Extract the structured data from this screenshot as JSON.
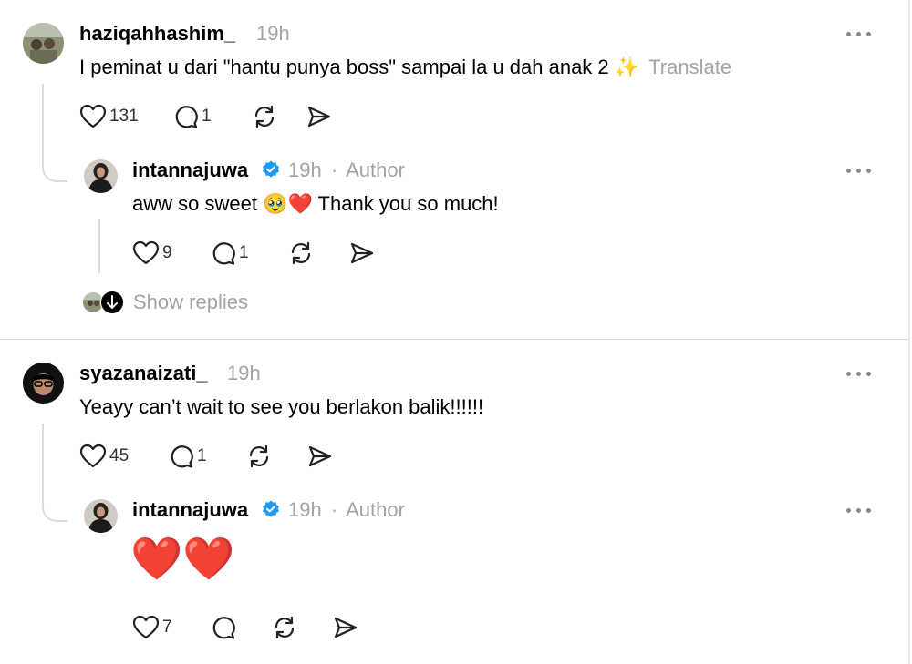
{
  "colors": {
    "muted": "#a3a3a3",
    "verified": "#1d9bf0",
    "heart": "#e0142b"
  },
  "comments": [
    {
      "username": "haziqahhashim_",
      "time": "19h",
      "text": "I peminat u dari \"hantu punya boss\" sampai la u dah anak 2 ✨",
      "translate": "Translate",
      "likes": "131",
      "replies": "1",
      "reply": {
        "username": "intannajuwa",
        "time": "19h",
        "separator": "·",
        "author_label": "Author",
        "text": "aww so sweet 🥹❤️ Thank you so much!",
        "likes": "9",
        "replies": "1"
      },
      "show_replies": "Show replies"
    },
    {
      "username": "syazanaizati_",
      "time": "19h",
      "text": "Yeayy can’t wait to see you berlakon balik!!!!!!",
      "likes": "45",
      "replies": "1",
      "reply": {
        "username": "intannajuwa",
        "time": "19h",
        "separator": "·",
        "author_label": "Author",
        "text": "❤️❤️",
        "likes": "7"
      }
    }
  ]
}
